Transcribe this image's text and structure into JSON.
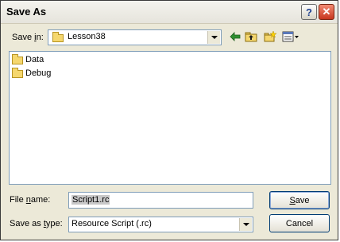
{
  "window": {
    "title": "Save As"
  },
  "titlebar": {
    "help_label": "?",
    "close_label": "✕"
  },
  "save_in": {
    "label_pre": "Save ",
    "label_accel": "i",
    "label_post": "n:",
    "value": "Lesson38"
  },
  "toolbar": {
    "back_icon": "back-arrow-icon",
    "up_icon": "up-one-level-icon",
    "new_folder_icon": "new-folder-icon",
    "view_menu_icon": "view-menu-icon"
  },
  "files": [
    {
      "name": "Data"
    },
    {
      "name": "Debug"
    }
  ],
  "file_name": {
    "label_pre": "File ",
    "label_accel": "n",
    "label_post": "ame:",
    "value": "Script1.rc"
  },
  "save_as_type": {
    "label_pre": "Save as ",
    "label_accel": "t",
    "label_post": "ype:",
    "value": "Resource Script (.rc)"
  },
  "buttons": {
    "save_accel": "S",
    "save_rest": "ave",
    "cancel": "Cancel"
  },
  "colors": {
    "face": "#ece9d8",
    "border_blue": "#7f9db9",
    "folder": "#f5d76e",
    "close_red": "#c7371f"
  }
}
